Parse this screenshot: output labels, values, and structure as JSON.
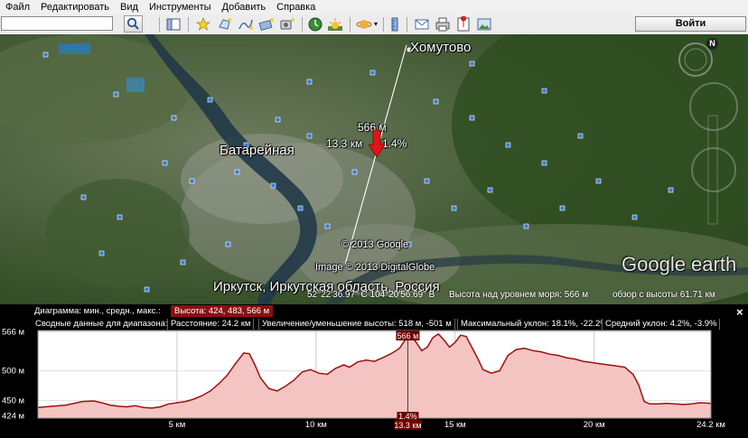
{
  "menu": [
    "Файл",
    "Редактировать",
    "Вид",
    "Инструменты",
    "Добавить",
    "Справка"
  ],
  "toolbar": {
    "search_value": "",
    "login_label": "Войти"
  },
  "map": {
    "labels": {
      "town_1": "Хомутово",
      "town_2": "Батарейная",
      "town_3": "Иркутск, Иркутская область, Россия",
      "elevation_mark": "566 м",
      "distance_mark": "13.3 км",
      "slope_mark": "1.4%",
      "copyright_1": "© 2013 Google",
      "copyright_2": "Image © 2013 DigitalGlobe",
      "brand": "Google earth"
    },
    "status": {
      "coords": "52°22'36.97\" С   104°20'56.69\" В",
      "elevation": "Высота над уровнем моря:    566 м",
      "eye_alt": "обзор с высоты   61.71 км"
    },
    "compass_letter": "N"
  },
  "profile": {
    "row1": {
      "chart_label": "Диаграмма: мин., средн., макс.:",
      "height_stat": "Высота: 424, 483, 566 м"
    },
    "row2": {
      "range_label": "Сводные данные для диапазона:",
      "distance": "Расстояние: 24.2 км",
      "gain_loss": "Увеличение/уменьшение высоты: 518 м, -501 м",
      "max_slope": "Максимальный уклон: 18.1%, -22.2%",
      "avg_slope": "Средний уклон: 4.2%, -3.9%"
    },
    "close": "×"
  },
  "chart_data": {
    "type": "area",
    "xlabel": "",
    "ylabel": "",
    "x_unit": "км",
    "y_unit": "м",
    "xlim": [
      0,
      24.2
    ],
    "ylim": [
      420,
      568
    ],
    "y_ticks": [
      "566 м",
      "500 м",
      "450 м",
      "424 м"
    ],
    "y_tick_values": [
      566,
      500,
      450,
      424
    ],
    "x_ticks": [
      "5 км",
      "10 км",
      "15 км",
      "20 км",
      "24.2 км"
    ],
    "x_tick_values": [
      5,
      10,
      15,
      20,
      24.2
    ],
    "cursor": {
      "x": 13.3,
      "y": 566,
      "x_label": "13.3 км",
      "y_label": "566 м",
      "slope_label": "1.4%"
    },
    "colors": {
      "fill": "#f4c4c2",
      "line": "#a01010",
      "marker_bg": "#6e0000"
    },
    "series": [
      {
        "x": [
          0,
          0.5,
          1,
          1.3,
          1.6,
          2,
          2.3,
          2.6,
          2.9,
          3.2,
          3.5,
          3.8,
          4.1,
          4.4,
          4.7,
          5,
          5.3,
          5.6,
          5.9,
          6.2,
          6.5,
          6.8,
          7.1,
          7.4,
          7.6,
          7.8,
          8,
          8.3,
          8.6,
          8.9,
          9.2,
          9.5,
          9.8,
          10.1,
          10.4,
          10.7,
          11,
          11.2,
          11.5,
          11.8,
          12.1,
          12.4,
          12.7,
          13,
          13.2,
          13.3,
          13.4,
          13.6,
          13.8,
          14,
          14.2,
          14.4,
          14.6,
          14.8,
          15,
          15.2,
          15.4,
          15.6,
          15.8,
          16,
          16.3,
          16.6,
          16.9,
          17.2,
          17.5,
          17.8,
          18.1,
          18.4,
          18.7,
          19,
          19.3,
          19.6,
          19.9,
          20.2,
          20.5,
          20.8,
          21.1,
          21.2,
          21.4,
          21.6,
          21.8,
          22,
          22.3,
          22.6,
          22.9,
          23.2,
          23.5,
          23.8,
          24.2
        ],
        "values": [
          438,
          440,
          442,
          445,
          448,
          449,
          446,
          442,
          440,
          439,
          441,
          438,
          437,
          439,
          444,
          446,
          448,
          452,
          458,
          466,
          478,
          492,
          512,
          530,
          529,
          510,
          488,
          470,
          466,
          474,
          484,
          498,
          502,
          496,
          494,
          504,
          510,
          506,
          515,
          518,
          516,
          522,
          529,
          538,
          552,
          566,
          560,
          548,
          534,
          540,
          556,
          562,
          552,
          540,
          548,
          560,
          558,
          540,
          522,
          502,
          496,
          500,
          526,
          536,
          538,
          534,
          532,
          528,
          526,
          522,
          520,
          516,
          514,
          512,
          510,
          508,
          506,
          502,
          494,
          476,
          448,
          444,
          444,
          445,
          444,
          443,
          444,
          446,
          445
        ]
      }
    ]
  }
}
